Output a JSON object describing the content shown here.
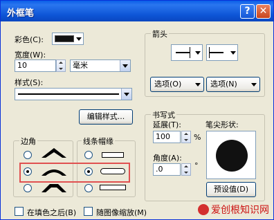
{
  "window": {
    "title": "外框笔",
    "help": "?",
    "close": "✕"
  },
  "color": {
    "label": "彩色(C):",
    "value": "#111111"
  },
  "width": {
    "label": "宽度(W):",
    "value": "10",
    "unit": "毫米"
  },
  "style": {
    "label": "样式(S):"
  },
  "edit_style_label": "编辑样式...",
  "arrows": {
    "title": "箭头",
    "options_left": "选项(O)",
    "options_right": "选项(N)"
  },
  "calligraphy": {
    "title": "书写式",
    "stretch_label": "延展(T):",
    "stretch_value": "100",
    "stretch_unit": "%",
    "angle_label": "角度(A):",
    "angle_value": ".0",
    "angle_unit": "°",
    "nib_label": "笔尖形状:",
    "default_label": "预设值(D)"
  },
  "corners": {
    "title": "边角",
    "selected": 1
  },
  "caps": {
    "title": "线条帽缘",
    "selected": 1
  },
  "options": {
    "behind_fill": "在填色之后(B)",
    "scale_with_image": "随图像缩放(M)"
  },
  "watermark": "爱创根知识网"
}
